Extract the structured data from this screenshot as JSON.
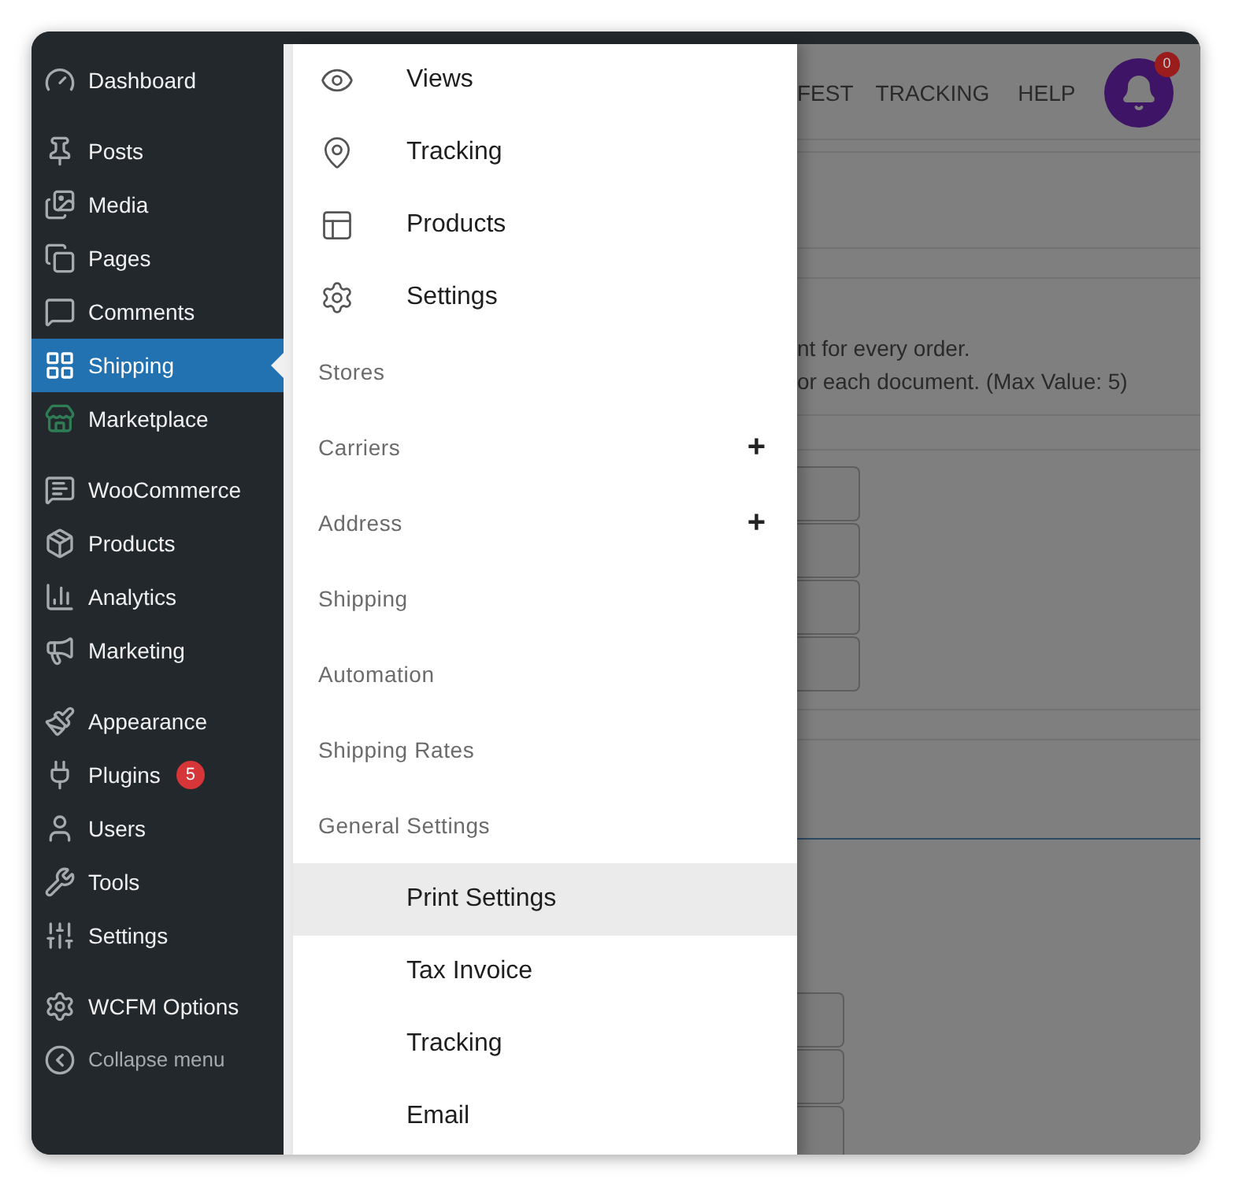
{
  "sidebar": {
    "groups": [
      [
        {
          "kind": "menu",
          "label": "Dashboard",
          "selected": false
        }
      ],
      [
        {
          "kind": "menu",
          "label": "Posts",
          "selected": false
        },
        {
          "kind": "menu",
          "label": "Media",
          "selected": false
        },
        {
          "kind": "menu",
          "label": "Pages",
          "selected": false
        },
        {
          "kind": "menu",
          "label": "Comments",
          "selected": false
        },
        {
          "kind": "menu",
          "label": "Shipping",
          "selected": true
        },
        {
          "kind": "menu",
          "label": "Marketplace",
          "selected": false
        }
      ],
      [
        {
          "kind": "menu",
          "label": "WooCommerce",
          "selected": false
        },
        {
          "kind": "menu",
          "label": "Products",
          "selected": false
        },
        {
          "kind": "menu",
          "label": "Analytics",
          "selected": false
        },
        {
          "kind": "menu",
          "label": "Marketing",
          "selected": false
        }
      ],
      [
        {
          "kind": "menu",
          "label": "Appearance",
          "selected": false
        },
        {
          "kind": "menu",
          "label": "Plugins",
          "selected": false,
          "badge": "5"
        },
        {
          "kind": "menu",
          "label": "Users",
          "selected": false
        },
        {
          "kind": "menu",
          "label": "Tools",
          "selected": false
        },
        {
          "kind": "menu",
          "label": "Settings",
          "selected": false
        }
      ],
      [
        {
          "kind": "menu",
          "label": "WCFM Options",
          "selected": false
        },
        {
          "kind": "collapse",
          "label": "Collapse menu",
          "selected": false
        }
      ]
    ]
  },
  "drawer": {
    "items": [
      {
        "kind": "icon",
        "label": "Views",
        "selected": false
      },
      {
        "kind": "icon",
        "label": "Tracking",
        "selected": false
      },
      {
        "kind": "icon",
        "label": "Products",
        "selected": false
      },
      {
        "kind": "icon",
        "label": "Settings",
        "selected": false
      },
      {
        "kind": "section",
        "label": "Stores",
        "selected": false
      },
      {
        "kind": "section",
        "label": "Carriers",
        "selected": false,
        "toggle": "+"
      },
      {
        "kind": "section",
        "label": "Address",
        "selected": false,
        "toggle": "+"
      },
      {
        "kind": "section",
        "label": "Shipping",
        "selected": false
      },
      {
        "kind": "section",
        "label": "Automation",
        "selected": false
      },
      {
        "kind": "section",
        "label": "Shipping Rates",
        "selected": false
      },
      {
        "kind": "section",
        "label": "General Settings",
        "selected": false
      },
      {
        "kind": "sub",
        "label": "Print Settings",
        "selected": true
      },
      {
        "kind": "sub",
        "label": "Tax Invoice",
        "selected": false
      },
      {
        "kind": "sub",
        "label": "Tracking",
        "selected": false
      },
      {
        "kind": "sub",
        "label": "Email",
        "selected": false
      }
    ]
  },
  "background": {
    "nav": [
      "FEST",
      "TRACKING",
      "HELP"
    ],
    "notification_count": "0",
    "notes": [
      "nt for every order.",
      "or each document. (Max Value: 5)"
    ]
  }
}
